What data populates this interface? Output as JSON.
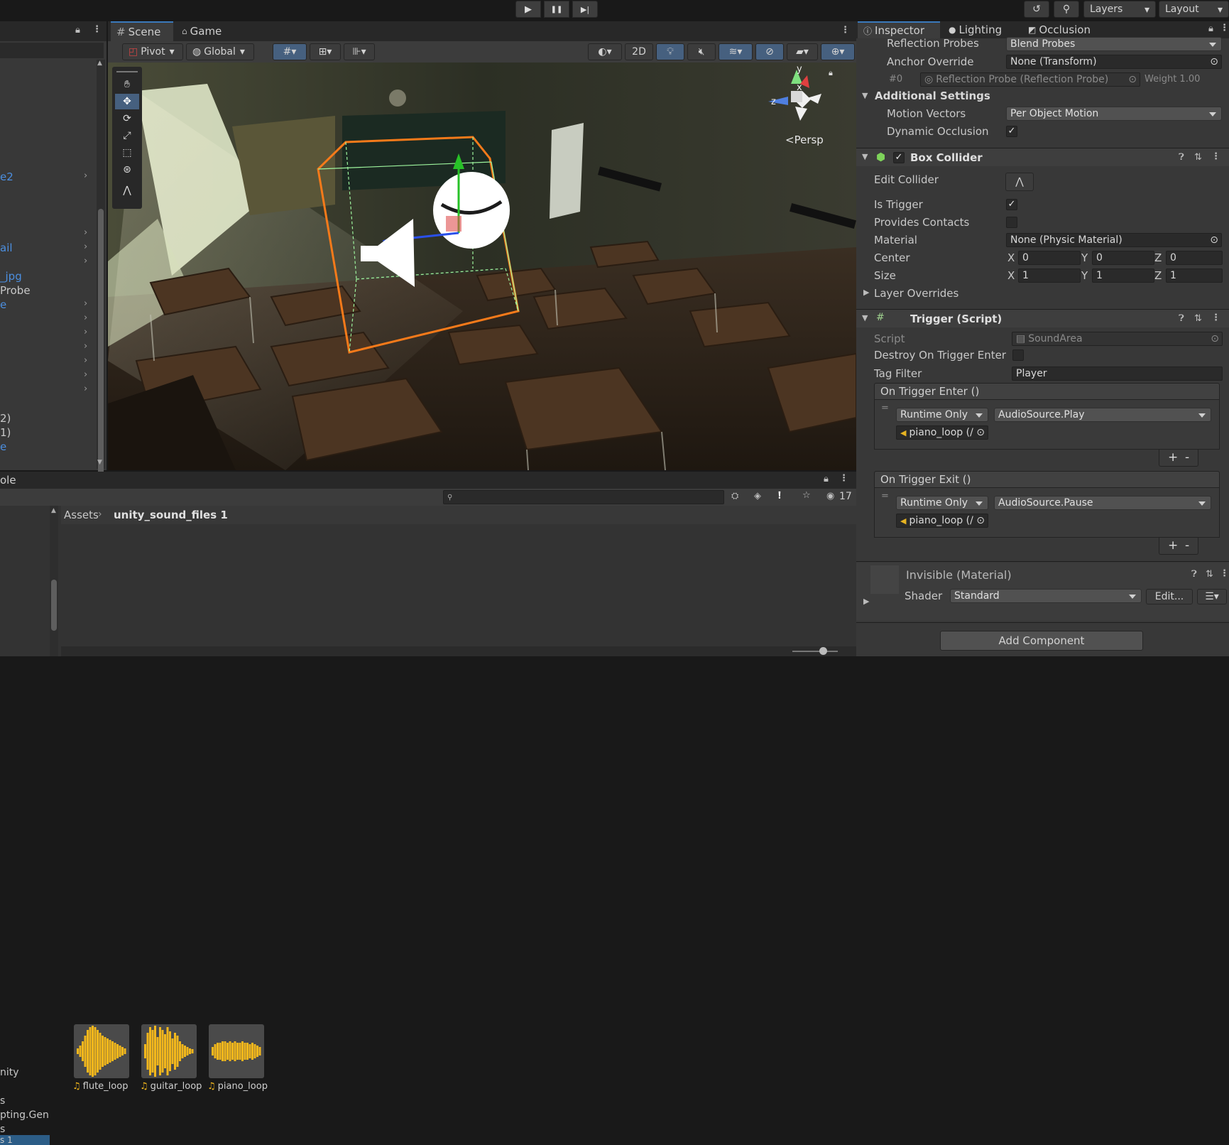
{
  "top_toolbar": {
    "layers": "Layers",
    "layout": "Layout",
    "play_glyph": "▶",
    "pause_glyph": "❚❚",
    "step_glyph": "▶|"
  },
  "hierarchy": {
    "items": [
      {
        "text": "e2",
        "color": "#4c8fe0"
      },
      {
        "text": "ail",
        "color": "#4c8fe0"
      },
      {
        "text": "_jpg",
        "color": "#4c8fe0"
      },
      {
        "text": "Probe",
        "color": "#c8c8c8"
      },
      {
        "text": "e",
        "color": "#4c8fe0"
      },
      {
        "text": "2)",
        "color": "#c8c8c8"
      },
      {
        "text": "1)",
        "color": "#c8c8c8"
      },
      {
        "text": "e",
        "color": "#4c8fe0"
      }
    ]
  },
  "scene": {
    "tabs": [
      "Scene",
      "Game"
    ],
    "pivot": "Pivot",
    "global": "Global",
    "mode_2d": "2D",
    "persp": "Persp",
    "axis_y": "y",
    "axis_x": "x",
    "axis_z": "z"
  },
  "inspector": {
    "tabs": [
      "Inspector",
      "Lighting",
      "Occlusion"
    ],
    "reflection_probes_label": "Reflection Probes",
    "reflection_probes_value": "Blend Probes",
    "anchor_override_label": "Anchor Override",
    "anchor_override_value": "None (Transform)",
    "probe_index": "#0",
    "probe_name": "Reflection Probe (Reflection Probe)",
    "probe_weight": "Weight 1.00",
    "additional_settings": "Additional Settings",
    "motion_vectors_label": "Motion Vectors",
    "motion_vectors_value": "Per Object Motion",
    "dynamic_occlusion_label": "Dynamic Occlusion",
    "box_collider": {
      "title": "Box Collider",
      "edit_collider": "Edit Collider",
      "is_trigger": "Is Trigger",
      "provides_contacts": "Provides Contacts",
      "material_label": "Material",
      "material_value": "None (Physic Material)",
      "center_label": "Center",
      "size_label": "Size",
      "center": {
        "x": "0",
        "y": "0",
        "z": "0"
      },
      "size": {
        "x": "1",
        "y": "1",
        "z": "1"
      },
      "axis_x": "X",
      "axis_y": "Y",
      "axis_z": "Z",
      "layer_overrides": "Layer Overrides"
    },
    "trigger_script": {
      "title": "Trigger (Script)",
      "script_label": "Script",
      "script_value": "SoundArea",
      "destroy_label": "Destroy On Trigger Enter",
      "tag_filter_label": "Tag Filter",
      "tag_filter_value": "Player",
      "on_enter": {
        "title": "On Trigger Enter ()",
        "runtime": "Runtime Only",
        "function": "AudioSource.Play",
        "object": "piano_loop (/"
      },
      "on_exit": {
        "title": "On Trigger Exit ()",
        "runtime": "Runtime Only",
        "function": "AudioSource.Pause",
        "object": "piano_loop (/"
      },
      "plus": "+",
      "minus": "-"
    },
    "material": {
      "name": "Invisible (Material)",
      "shader_label": "Shader",
      "shader_value": "Standard",
      "edit": "Edit..."
    },
    "add_component": "Add Component"
  },
  "project": {
    "panel_label": "ole",
    "breadcrumb_root": "Assets",
    "breadcrumb_folder": "unity_sound_files 1",
    "count": "17",
    "tree_items": [
      "nity",
      "s",
      "pting.Gen",
      "s",
      "s 1"
    ],
    "assets": [
      {
        "name": "flute_loop"
      },
      {
        "name": "guitar_loop"
      },
      {
        "name": "piano_loop"
      }
    ]
  }
}
